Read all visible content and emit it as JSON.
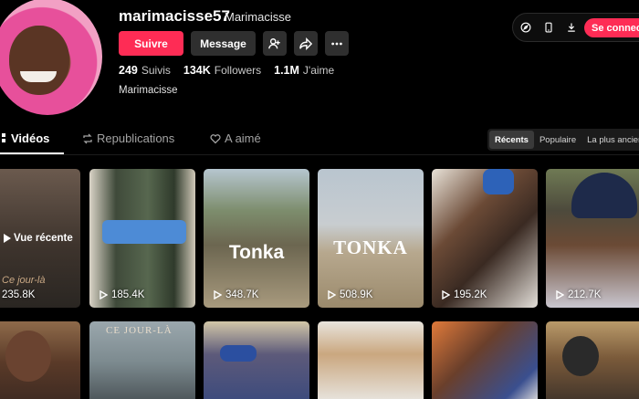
{
  "profile": {
    "username": "marimacisse57",
    "nickname": "Marimacisse",
    "bio": "Marimacisse",
    "follow_label": "Suivre",
    "message_label": "Message",
    "stats": [
      {
        "value": "249",
        "label": "Suivis"
      },
      {
        "value": "134K",
        "label": "Followers"
      },
      {
        "value": "1.1M",
        "label": "J'aime"
      }
    ]
  },
  "topbar": {
    "connect_label": "Se connecter"
  },
  "tabs": [
    {
      "label": "Vidéos",
      "icon": "grid-icon"
    },
    {
      "label": "Republications",
      "icon": "repost-icon"
    },
    {
      "label": "A aimé",
      "icon": "heart-lock-icon"
    }
  ],
  "sort": [
    "Récents",
    "Populaire",
    "La plus ancienne"
  ],
  "videos": [
    {
      "views": "235.8K",
      "overlay": "Vue récente",
      "watermark": "Ce jour-là"
    },
    {
      "views": "185.4K"
    },
    {
      "views": "348.7K",
      "caption": "Tonka"
    },
    {
      "views": "508.9K",
      "caption": "TONKA"
    },
    {
      "views": "195.2K"
    },
    {
      "views": "212.7K"
    },
    {
      "views": ""
    },
    {
      "views": "",
      "watermark": "CE JOUR-LÀ"
    },
    {
      "views": ""
    },
    {
      "views": ""
    },
    {
      "views": ""
    },
    {
      "views": ""
    }
  ],
  "colors": {
    "accent": "#fe2c55",
    "background": "#000000"
  }
}
